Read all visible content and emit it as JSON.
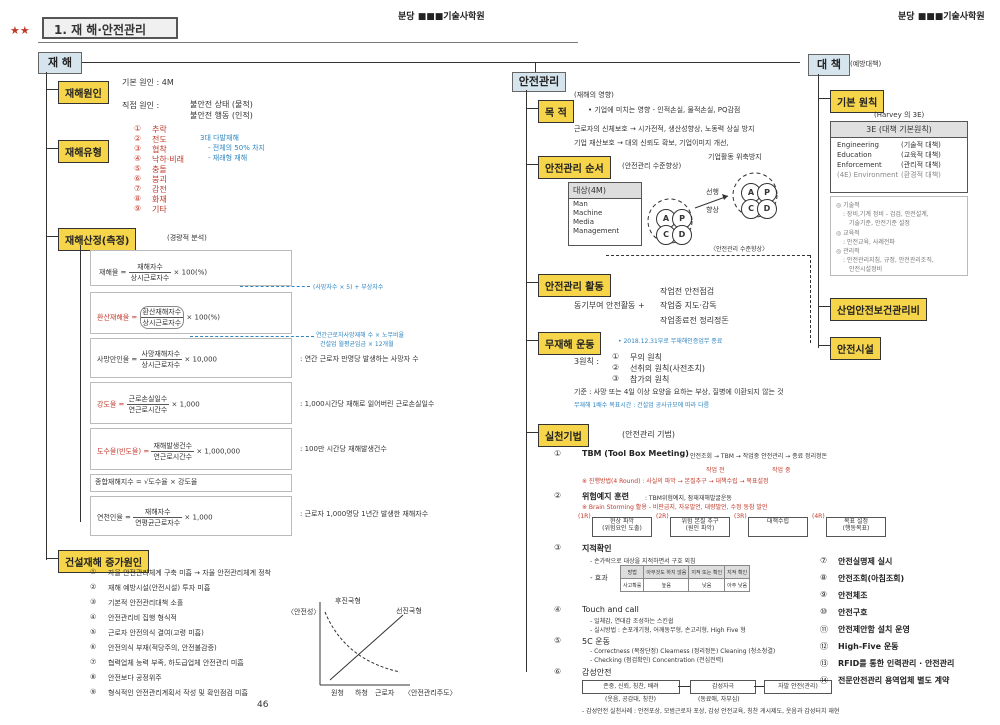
{
  "header": {
    "stars": "★★",
    "title": "1. 재 해·안전관리",
    "logo_left": "분당 ■■■기술사학원",
    "logo_right": "분당 ■■■기술사학원"
  },
  "left": {
    "tab": "재 해",
    "s1": {
      "title": "재해원인",
      "basic": "기본 원인 : 4M",
      "direct": "직접 원인 :",
      "unsafe_state": "불안전 상태 (물적)",
      "unsafe_act": "불안전 행동 (인적)"
    },
    "s2": {
      "title": "재해유형",
      "items": [
        {
          "n": "①",
          "t": "추락"
        },
        {
          "n": "②",
          "t": "전도"
        },
        {
          "n": "③",
          "t": "협착"
        },
        {
          "n": "④",
          "t": "낙하·비래"
        },
        {
          "n": "⑤",
          "t": "충돌"
        },
        {
          "n": "⑥",
          "t": "붕괴"
        },
        {
          "n": "⑦",
          "t": "감전"
        },
        {
          "n": "⑧",
          "t": "화재"
        },
        {
          "n": "⑨",
          "t": "기타"
        }
      ],
      "note1": "3대 다발재해",
      "note2": "- 전체의 50% 차지",
      "note3": "- 재래형 재해"
    },
    "s3": {
      "title": "재해산정(측정)",
      "subtitle": "(경량적 분석)",
      "f1": {
        "label": "재해율 =",
        "num": "재해자수",
        "den": "상시근로자수",
        "mult": "× 100(%)"
      },
      "f1_note": "(사망자수 × 5) + 부상자수",
      "f2": {
        "label": "환산재해율 =",
        "num": "환산재해자수",
        "den": "상시근로자수",
        "mult": "× 100(%)"
      },
      "f2_note1": "연간근로자사망재해 수 × 노무비율",
      "f2_note2": "건설업 월평균임금 × 12개월",
      "f3": {
        "label": "사망만인율 =",
        "num": "사망재해자수",
        "den": "상시근로자수",
        "mult": "× 10,000"
      },
      "f3_desc": ": 연간 근로자 만명당 발생하는 사망자 수",
      "f4": {
        "label": "강도율 =",
        "num": "근로손실일수",
        "den": "연근로시간수",
        "mult": "× 1,000"
      },
      "f4_desc": ": 1,000시간당 재해로 잃어버린 근로손실일수",
      "f5": {
        "label": "도수율(빈도율) =",
        "num": "재해발생건수",
        "den": "연근로시간수",
        "mult": "× 1,000,000"
      },
      "f5_desc": ": 100만 시간당 재해발생건수",
      "f6": "종합재해지수 = √도수율 × 강도율",
      "f7": {
        "label": "연천인율 =",
        "num": "재해자수",
        "den": "연평균근로자수",
        "mult": "× 1,000"
      },
      "f7_desc": ": 근로자 1,000명당 1년간 발생한 재해자수"
    },
    "s4": {
      "title": "건설재해 증가원인",
      "items": [
        {
          "n": "①",
          "t": "자율 안전관리체계 구축 미흡  → 자율 안전관리체계 정착"
        },
        {
          "n": "②",
          "t": "재해 예방시설(안전시설) 투자 미흡"
        },
        {
          "n": "③",
          "t": "기본적 안전관리대책 소홀"
        },
        {
          "n": "④",
          "t": "안전관리비 집행 형식적"
        },
        {
          "n": "⑤",
          "t": "근로자 안전의식 결여(고령 미흡)"
        },
        {
          "n": "⑥",
          "t": "안전의식 부재(적당주의, 안전불감증)"
        },
        {
          "n": "⑦",
          "t": "협력업체 능력 부족, 하도급업체 안전관리 미흡"
        },
        {
          "n": "⑧",
          "t": "안전보다 공정위주"
        },
        {
          "n": "⑨",
          "t": "형식적인 안전관리계획서 작성 및 확인점검 미흡"
        }
      ],
      "graph": {
        "y_label": "〈안전성〉",
        "curve1": "후진국형",
        "curve2": "선진국형",
        "x_ticks": [
          "원청",
          "하청",
          "근로자"
        ],
        "x_label": "〈안전관리주도〉"
      }
    },
    "page_no": "46"
  },
  "mid": {
    "tab": "안전관리",
    "s1": {
      "title": "목 적",
      "pre": "(재해의 영향)",
      "l1": "• 기업에 미치는 영향 - 인적손실, 물적손실, PQ감점",
      "l2": "근로자의 신체보호 → 시가전적, 생산성향상, 노동력 상실 방지",
      "l3": "기업 재산보호   → 대외 신뢰도 확보, 기업이미지 개선,",
      "l4": "기업활동 위축방지"
    },
    "s2": {
      "title": "안전관리 순서",
      "sub": "(안전관리 수준향상)",
      "box_title": "대상(4M)",
      "m": [
        "Man",
        "Machine",
        "Media",
        "Management"
      ],
      "improve1": "선행",
      "improve2": "향상",
      "cycle": [
        "A",
        "P",
        "C",
        "D"
      ],
      "note": "〈안전관리 수준향상〉"
    },
    "s3": {
      "title": "안전관리 활동",
      "left": "동기부여 안전활동  +",
      "r1": "작업전 안전점검",
      "r2": "작업중 지도·감독",
      "r3": "작업종료전 정리정돈"
    },
    "s4": {
      "title": "무재해 운동",
      "date": "• 2018.12.31부로 무재해인증업무 종료",
      "principle": "3원칙 :",
      "p": [
        {
          "n": "①",
          "t": "무의 원칙"
        },
        {
          "n": "②",
          "t": "선취의 원칙(사전조치)"
        },
        {
          "n": "③",
          "t": "참가의 원칙"
        }
      ],
      "std": "기준 : 사망 또는 4일 이상 요양을 요하는 부상, 질병에 이환되지 않는 것",
      "time": "무재해 1배수 목표시간 : 건설업 공사규모에 따라 다름"
    },
    "s5": {
      "title": "실천기법",
      "sub": "(안전관리 기법)",
      "i1": {
        "n": "①",
        "t": "TBM (Tool Box Meeting)",
        "flow": "안전조회 → TBM → 작업중 안전관리 → 종료 정리정돈",
        "f2": "작업 전",
        "f3": "작업 중",
        "note": "※ 진행방법(4 Round) : 사실의 파악 → 본질추구 → 대책수립 → 목표설정"
      },
      "i2": {
        "n": "②",
        "t": "위험예지 훈련",
        "desc": ": TBM위험예지, 잠재재해발굴운동",
        "note": "※ Brain Storming 활용 - 비판금지, 자유발언, 대량발언, 수정 동참 발언",
        "steps": [
          "현상 파악\n(위험요인 도출)",
          "위험 본질 추구\n(원인 파악)",
          "대책수립",
          "목표 설정\n(행동목표)"
        ],
        "labels": [
          "(1R)",
          "(2R)",
          "(3R)",
          "(4R)"
        ]
      },
      "i3": {
        "n": "③",
        "t": "지적확인",
        "desc": "- 손가락으로 대상을 지적하면서 구호 외침",
        "effect": "- 효과",
        "table": {
          "h": [
            "방법",
            "아무것도\n하지 않음",
            "지적\n또는 확인",
            "지적 확인"
          ],
          "r": [
            "사고확률",
            "높음",
            "낮음",
            "아주 낮음"
          ]
        }
      },
      "i4": {
        "n": "④",
        "t": "Touch and call",
        "d1": "- 일체감, 연대감 조성하는 스킨쉽",
        "d2": "- 실시방법 : 손포개기형, 어깨동무형, 손고리형, High Five 형"
      },
      "i5": {
        "n": "⑤",
        "t": "5C 운동",
        "d1": "- Correctness (복장단정)   Clearness (정리정돈)   Cleaning (청소청결)",
        "d2": "- Checking (점검확인)   Concentration (전심전력)"
      },
      "i6": {
        "n": "⑥",
        "t": "감성안전",
        "b": [
          "존중, 신뢰, 칭찬, 배려",
          "감성자극",
          "자발 안전(관리)"
        ],
        "bl": [
          "(웃음, 공감대, 칭찬)",
          "(동료애, 자부심)"
        ],
        "note": "- 감성안전 실천사례 : 안전포상, 모범근로자 포상, 감성 안전교육, 칭찬 게시제도, 웃음과 감성터치 재현"
      }
    }
  },
  "right": {
    "tab": "대 책",
    "tab_note": "(예방대책)",
    "s1": {
      "title": "기본 원칙",
      "sub": "(Harvey 의 3E)",
      "box_title": "3E (대책 기본원칙)",
      "rows": [
        {
          "a": "Engineering",
          "b": "(기술적 대책)"
        },
        {
          "a": "Education",
          "b": "(교육적 대책)"
        },
        {
          "a": "Enforcement",
          "b": "(관리적 대책)"
        },
        {
          "a": "(4E) Environment",
          "b": "(환경적 대책)"
        }
      ],
      "g1": "◎ 기술적",
      "g1d": ": 장비,기계 정비 - 검검, 안전설계,",
      "g1e": "기술기준, 안전기준 설정",
      "g2": "◎ 교육적",
      "g2d": ": 안전교육, 사례전파",
      "g3": "◎ 관리적",
      "g3d": ": 안전관리지침, 규정, 안전관리조직,",
      "g3e": "안전시설정비"
    },
    "s2": {
      "title": "산업안전보건관리비"
    },
    "s3": {
      "title": "안전시설"
    },
    "list": [
      {
        "n": "⑦",
        "t": "안전실명제 실시"
      },
      {
        "n": "⑧",
        "t": "안전조회(아침조회)"
      },
      {
        "n": "⑨",
        "t": "안전체조"
      },
      {
        "n": "⑩",
        "t": "안전구호"
      },
      {
        "n": "⑪",
        "t": "안전제안함 설치 운영"
      },
      {
        "n": "⑫",
        "t": "High-Five 운동"
      },
      {
        "n": "⑬",
        "t": "RFID를 통한 인력관리 · 안전관리"
      },
      {
        "n": "⑭",
        "t": "전문안전관리 용역업체 별도 계약"
      }
    ]
  },
  "colors": {
    "accent": "#f7d54a",
    "tab": "#d6e4ee",
    "red": "#c0392b",
    "blue": "#2e86c1"
  }
}
